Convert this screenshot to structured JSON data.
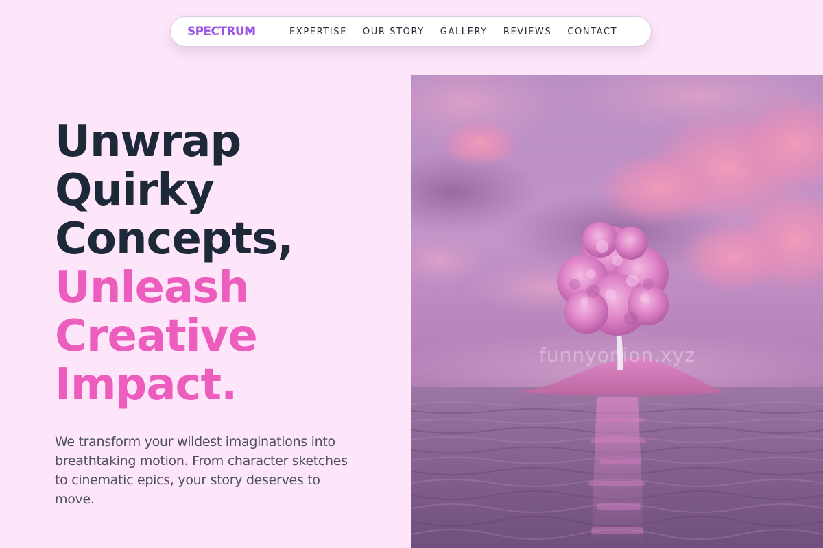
{
  "nav": {
    "brand": "SPECTRUM",
    "links": [
      "EXPERTISE",
      "OUR STORY",
      "GALLERY",
      "REVIEWS",
      "CONTACT"
    ]
  },
  "hero": {
    "headline_dark": [
      "Unwrap",
      "Quirky",
      "Concepts,"
    ],
    "headline_pink": [
      "Unleash",
      "Creative",
      "Impact."
    ],
    "description": "We transform your wildest imaginations into breathtaking motion. From character sketches to cinematic epics, your story deserves to move."
  },
  "image": {
    "watermark": "funnyonion.xyz"
  },
  "colors": {
    "background": "#fde6fa",
    "brand": "#9a55e4",
    "headline_dark": "#1d2838",
    "headline_pink": "#ec5dbd",
    "body_text": "#4d4f62"
  }
}
